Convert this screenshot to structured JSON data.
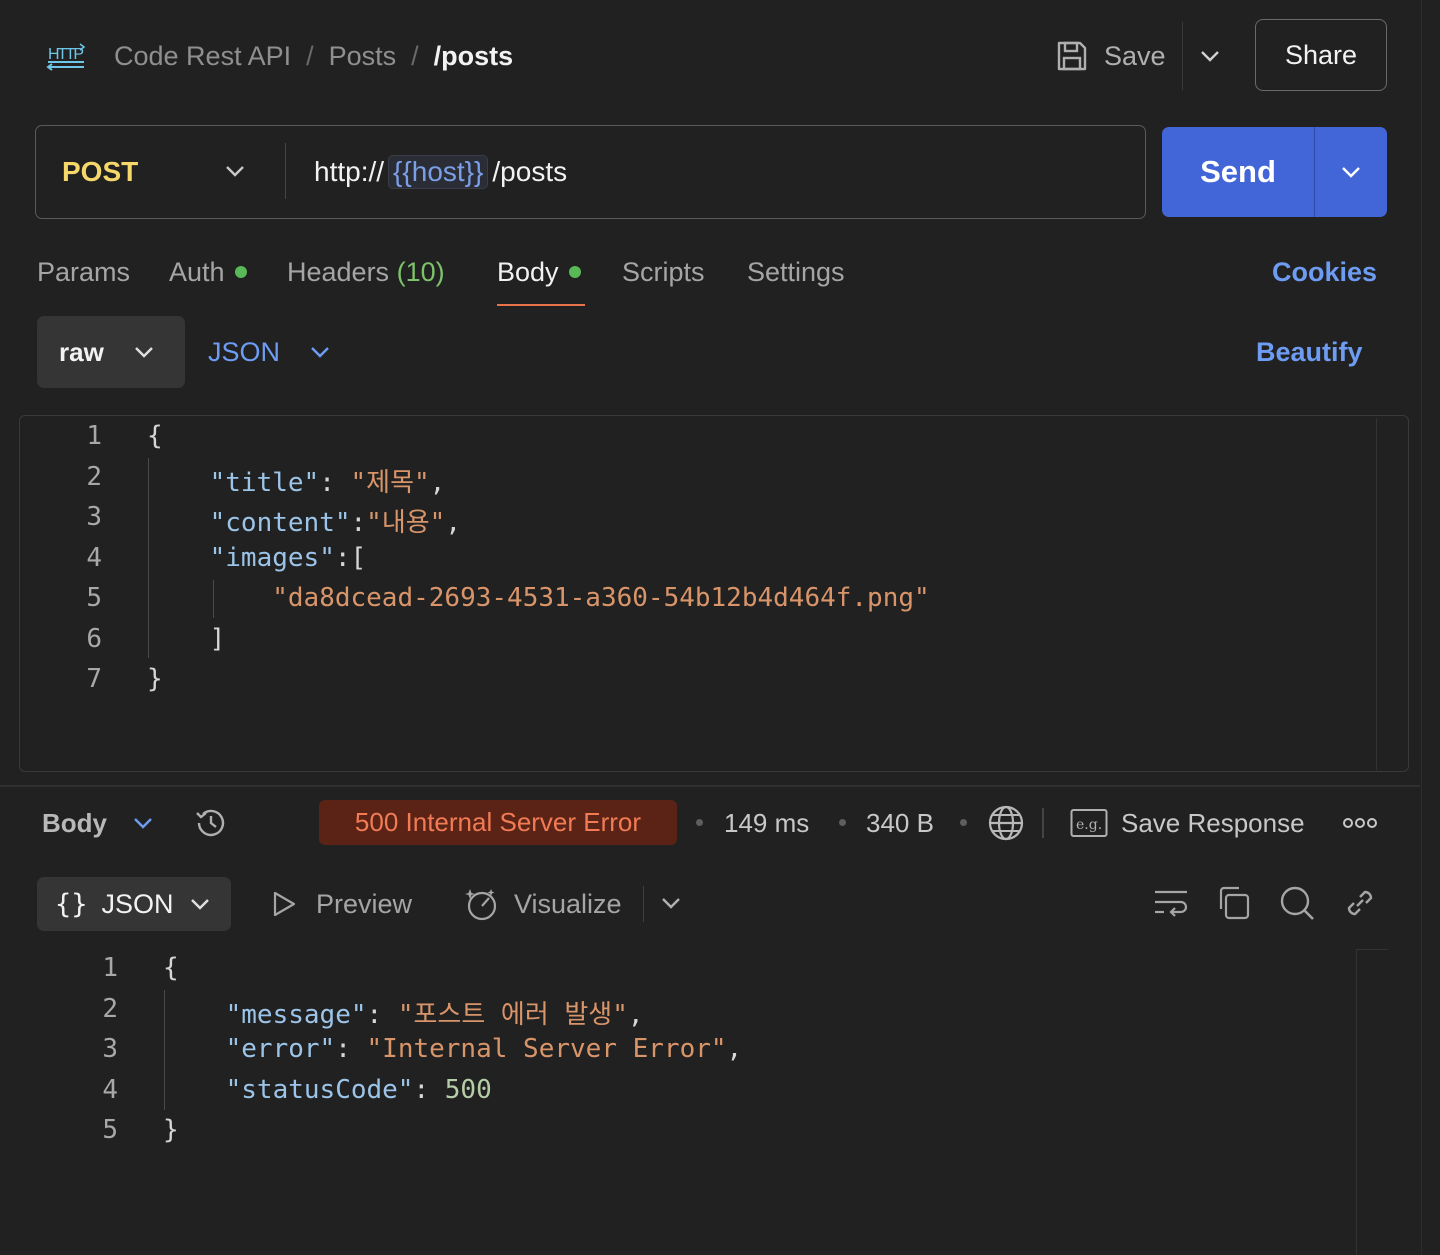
{
  "header": {
    "breadcrumb": [
      "Code Rest API",
      "Posts",
      "/posts"
    ],
    "save_label": "Save",
    "share_label": "Share"
  },
  "request": {
    "method": "POST",
    "url_prefix": "http://",
    "url_variable": "{{host}}",
    "url_suffix": "/posts",
    "send_label": "Send"
  },
  "tabs": [
    {
      "label": "Params"
    },
    {
      "label": "Auth",
      "dot": true
    },
    {
      "label": "Headers",
      "count": "(10)"
    },
    {
      "label": "Body",
      "dot": true,
      "active": true
    },
    {
      "label": "Scripts"
    },
    {
      "label": "Settings"
    }
  ],
  "cookies_label": "Cookies",
  "body_options": {
    "mode": "raw",
    "format": "JSON",
    "beautify_label": "Beautify"
  },
  "request_body": {
    "line_numbers": [
      "1",
      "2",
      "3",
      "4",
      "5",
      "6",
      "7"
    ],
    "lines": [
      [
        {
          "t": "{",
          "c": "p"
        }
      ],
      [
        {
          "t": "    ",
          "c": "p"
        },
        {
          "t": "\"title\"",
          "c": "k"
        },
        {
          "t": ": ",
          "c": "p"
        },
        {
          "t": "\"제목\"",
          "c": "s"
        },
        {
          "t": ",",
          "c": "p"
        }
      ],
      [
        {
          "t": "    ",
          "c": "p"
        },
        {
          "t": "\"content\"",
          "c": "k"
        },
        {
          "t": ":",
          "c": "p"
        },
        {
          "t": "\"내용\"",
          "c": "s"
        },
        {
          "t": ",",
          "c": "p"
        }
      ],
      [
        {
          "t": "    ",
          "c": "p"
        },
        {
          "t": "\"images\"",
          "c": "k"
        },
        {
          "t": ":[",
          "c": "p"
        }
      ],
      [
        {
          "t": "        ",
          "c": "p"
        },
        {
          "t": "\"da8dcead-2693-4531-a360-54b12b4d464f.png\"",
          "c": "s"
        }
      ],
      [
        {
          "t": "    ]",
          "c": "p"
        }
      ],
      [
        {
          "t": "}",
          "c": "p"
        }
      ]
    ]
  },
  "response": {
    "body_label": "Body",
    "status": "500 Internal Server Error",
    "time": "149 ms",
    "size": "340 B",
    "save_response_label": "Save Response",
    "view_format": "JSON",
    "preview_label": "Preview",
    "visualize_label": "Visualize",
    "line_numbers": [
      "1",
      "2",
      "3",
      "4",
      "5"
    ],
    "lines": [
      [
        {
          "t": "{",
          "c": "p"
        }
      ],
      [
        {
          "t": "    ",
          "c": "p"
        },
        {
          "t": "\"message\"",
          "c": "k"
        },
        {
          "t": ": ",
          "c": "p"
        },
        {
          "t": "\"포스트 에러 발생\"",
          "c": "s"
        },
        {
          "t": ",",
          "c": "p"
        }
      ],
      [
        {
          "t": "    ",
          "c": "p"
        },
        {
          "t": "\"error\"",
          "c": "k"
        },
        {
          "t": ": ",
          "c": "p"
        },
        {
          "t": "\"Internal Server Error\"",
          "c": "s"
        },
        {
          "t": ",",
          "c": "p"
        }
      ],
      [
        {
          "t": "    ",
          "c": "p"
        },
        {
          "t": "\"statusCode\"",
          "c": "k"
        },
        {
          "t": ": ",
          "c": "p"
        },
        {
          "t": "500",
          "c": "n"
        }
      ],
      [
        {
          "t": "}",
          "c": "p"
        }
      ]
    ]
  },
  "icons": [
    "http-icon",
    "save-icon",
    "chevron-down-icon",
    "history-icon",
    "globe-icon",
    "example-icon",
    "more-icon",
    "play-icon",
    "visualize-icon",
    "wrap-icon",
    "copy-icon",
    "search-icon",
    "link-icon"
  ],
  "colors": {
    "background": "#212121",
    "accent": "#4266d8",
    "link": "#6d9cf2",
    "method": "#f5d76a",
    "error_badge_bg": "#5a2315",
    "error_badge_text": "#f07b55",
    "tab_underline": "#e8734a",
    "status_dot": "#5ab957"
  }
}
